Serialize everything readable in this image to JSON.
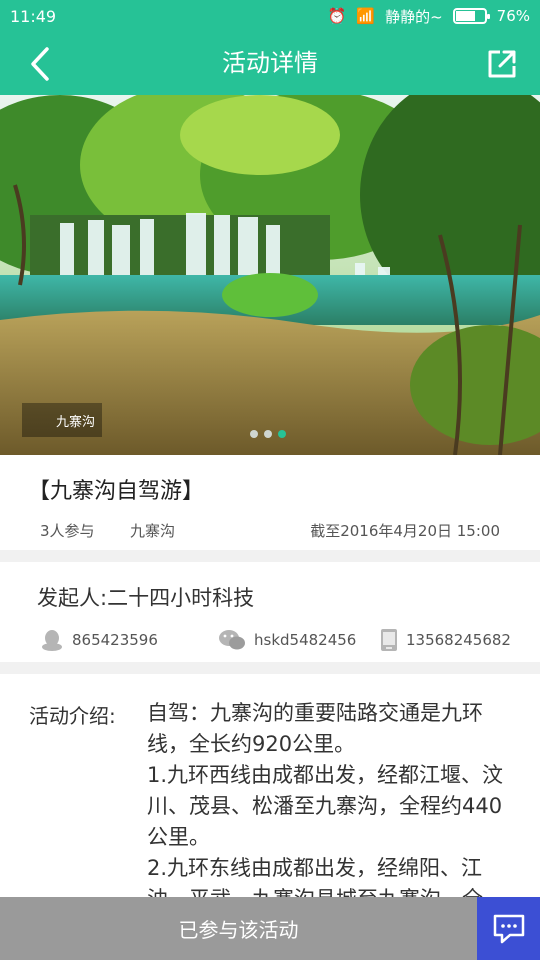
{
  "status": {
    "time": "11:49",
    "carrier": "静静的~",
    "battery_text": "76%",
    "battery_level": 0.76
  },
  "nav": {
    "title": "活动详情",
    "back_icon": "back-arrow-icon",
    "share_icon": "share-icon"
  },
  "hero": {
    "watermark_text": "九寨沟",
    "carousel_count": 3,
    "carousel_active": 2
  },
  "event": {
    "title": "【九寨沟自驾游】",
    "participants": "3人参与",
    "location": "九寨沟",
    "deadline": "截至2016年4月20日 15:00"
  },
  "organizer": {
    "label": "发起人:二十四小时科技",
    "qq": "865423596",
    "wechat": "hskd5482456",
    "phone": "13568245682"
  },
  "intro": {
    "label": "活动介绍:",
    "text": "自驾：九寨沟的重要陆路交通是九环线，全长约920公里。\n1.九环西线由成都出发，经都江堰、汶川、茂县、松潘至九寨沟，全程约440公里。\n2.九环东线由成都出发，经绵阳、江油、平武、九寨沟县城至九寨沟，全"
  },
  "bottom": {
    "join_label": "已参与该活动",
    "chat_icon": "chat-icon"
  },
  "colors": {
    "brand": "#26c296",
    "chat": "#3c4fd4",
    "disabled": "#9a9a9a"
  }
}
